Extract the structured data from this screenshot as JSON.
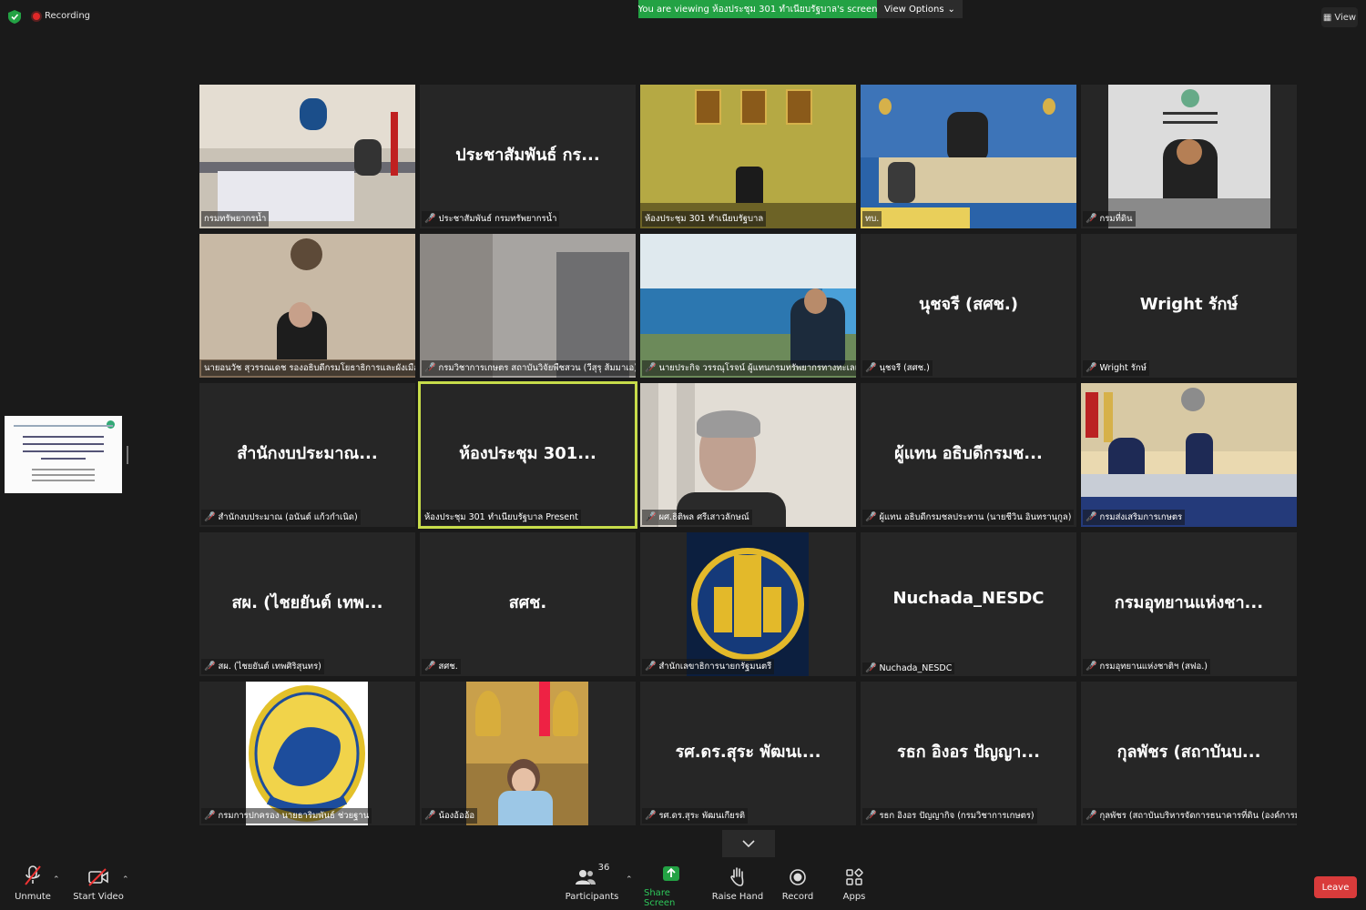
{
  "topbar": {
    "recording": "Recording",
    "viewing_banner": "You are viewing ห้องประชุม 301 ทำเนียบรัฐบาล's screen",
    "view_options": "View Options",
    "view": "View"
  },
  "tiles": [
    {
      "label": "กรมทรัพยากรน้ำ",
      "big": "",
      "muted": false
    },
    {
      "label": "ประชาสัมพันธ์ กรมทรัพยากรน้ำ",
      "big": "ประชาสัมพันธ์ กร...",
      "muted": true
    },
    {
      "label": "ห้องประชุม 301 ทำเนียบรัฐบาล",
      "big": "",
      "muted": false
    },
    {
      "label": "ทบ.",
      "big": "",
      "muted": false
    },
    {
      "label": "กรมที่ดิน",
      "big": "",
      "muted": true
    },
    {
      "label": "นายอนวัช สุวรรณเดช รองอธิบดีกรมโยธาธิการและผังเมือง",
      "big": "",
      "muted": false
    },
    {
      "label": "กรมวิชาการเกษตร สถาบันวิจัยพืชสวน (วีสุรุ ส้มมาเอ)",
      "big": "",
      "muted": true
    },
    {
      "label": "นายประกิจ วรรณุโรจน์ ผู้แทนกรมทรัพยากรทางทะเลและ...",
      "big": "",
      "muted": true
    },
    {
      "label": "นุชจรี (สศช.)",
      "big": "นุชจรี (สศช.)",
      "muted": true
    },
    {
      "label": "Wright รักษ์",
      "big": "Wright รักษ์",
      "muted": true
    },
    {
      "label": "สำนักงบประมาณ (อนันต์ แก้วกำเนิด)",
      "big": "สำนักงบประมาณ...",
      "muted": true
    },
    {
      "label": "ห้องประชุม 301 ทำเนียบรัฐบาล Present",
      "big": "ห้องประชุม 301...",
      "muted": false
    },
    {
      "label": "ผศ.ธิติพล ศรีเสาวลักษณ์",
      "big": "",
      "muted": true
    },
    {
      "label": "ผู้แทน อธิบดีกรมชลประทาน (นายชีวิน อินทรานุกูล)",
      "big": "ผู้แทน อธิบดีกรมช...",
      "muted": true
    },
    {
      "label": "กรมส่งเสริมการเกษตร",
      "big": "",
      "muted": true
    },
    {
      "label": "สผ. (ไชยยันต์ เทพศิริสุนทร)",
      "big": "สผ. (ไชยยันต์ เทพ...",
      "muted": true
    },
    {
      "label": "สศช.",
      "big": "สศช.",
      "muted": true
    },
    {
      "label": "สำนักเลขาธิการนายกรัฐมนตรี",
      "big": "",
      "muted": true
    },
    {
      "label": "Nuchada_NESDC",
      "big": "Nuchada_NESDC",
      "muted": true
    },
    {
      "label": "กรมอุทยานแห่งชาติฯ (สฟอ.)",
      "big": "กรมอุทยานแห่งชา...",
      "muted": true
    },
    {
      "label": "กรมการปกครอง นายธาริมพันธ์ ช่วยฐาน",
      "big": "",
      "muted": true
    },
    {
      "label": "น้องอ้ออ้อ",
      "big": "",
      "muted": true
    },
    {
      "label": "รศ.ดร.สุระ พัฒนเกียรติ",
      "big": "รศ.ดร.สุระ พัฒนเ...",
      "muted": true
    },
    {
      "label": "รธก อิงอร ปัญญากิจ (กรมวิชาการเกษตร)",
      "big": "รธก อิงอร ปัญญา...",
      "muted": true
    },
    {
      "label": "กุลพัชร (สถาบันบริหารจัดการธนาคารที่ดิน (องค์การมห...",
      "big": "กุลพัชร (สถาบันบ...",
      "muted": true
    }
  ],
  "toolbar": {
    "unmute": "Unmute",
    "start_video": "Start Video",
    "participants": "Participants",
    "participants_count": "36",
    "share_screen": "Share Screen",
    "raise_hand": "Raise Hand",
    "record": "Record",
    "apps": "Apps",
    "leave": "Leave"
  }
}
